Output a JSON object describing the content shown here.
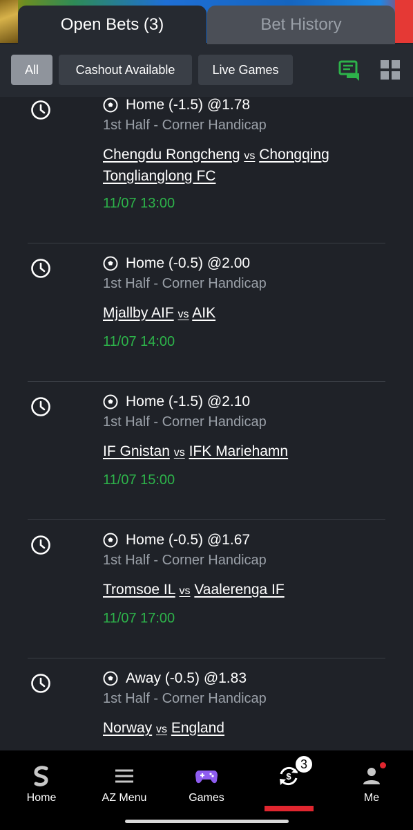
{
  "tabs": {
    "open_bets": "Open Bets (3)",
    "bet_history": "Bet History"
  },
  "filters": {
    "all": "All",
    "cashout": "Cashout Available",
    "live": "Live Games"
  },
  "bets": [
    {
      "selection": "Home (-1.5) @1.78",
      "market": "1st Half - Corner Handicap",
      "home": "Chengdu Rongcheng",
      "vs": "vs",
      "away": "Chongqing Tonglianglong FC",
      "time": "11/07 13:00"
    },
    {
      "selection": "Home (-0.5) @2.00",
      "market": "1st Half - Corner Handicap",
      "home": "Mjallby AIF",
      "vs": "vs",
      "away": "AIK",
      "time": "11/07 14:00"
    },
    {
      "selection": "Home (-1.5) @2.10",
      "market": "1st Half - Corner Handicap",
      "home": "IF Gnistan",
      "vs": "vs",
      "away": "IFK Mariehamn",
      "time": "11/07 15:00"
    },
    {
      "selection": "Home (-0.5) @1.67",
      "market": "1st Half - Corner Handicap",
      "home": "Tromsoe IL",
      "vs": "vs",
      "away": "Vaalerenga IF",
      "time": "11/07 17:00"
    },
    {
      "selection": "Away (-0.5) @1.83",
      "market": "1st Half - Corner Handicap",
      "home": "Norway",
      "vs": "vs",
      "away": "England",
      "time": ""
    }
  ],
  "nav": {
    "home": "Home",
    "az_menu": "AZ Menu",
    "games": "Games",
    "bets_badge": "3",
    "me": "Me"
  },
  "colors": {
    "accent_green": "#2db34a",
    "accent_red": "#e0262f",
    "games_purple": "#8e5cf0"
  },
  "icons": {
    "clock": "clock-icon",
    "ball": "soccer-ball-icon",
    "bet_slip": "bet-slip-icon",
    "grid": "grid-view-icon"
  }
}
